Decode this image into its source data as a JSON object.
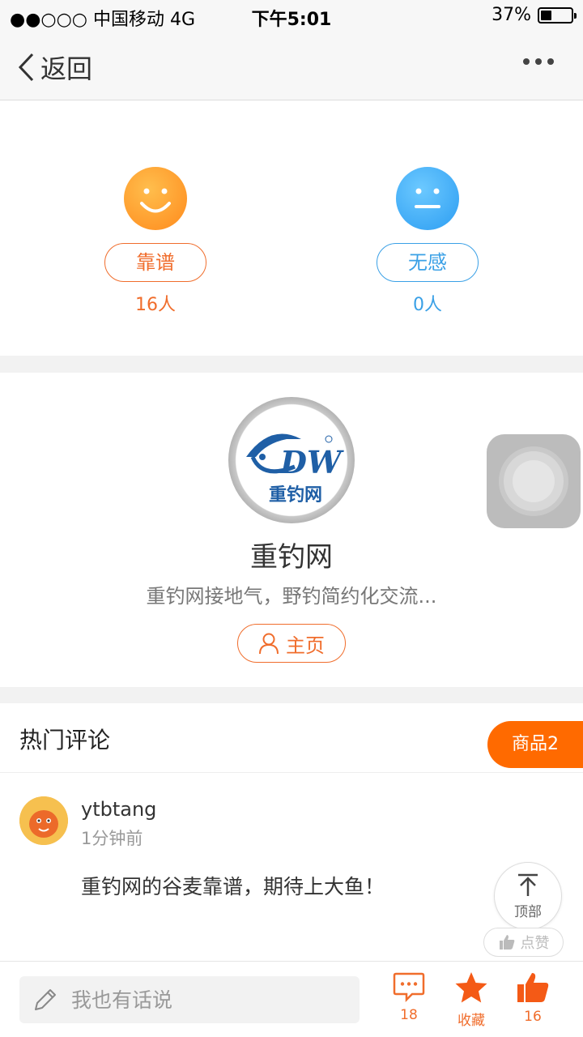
{
  "status_bar": {
    "carrier": "●●○○○ 中国移动   4G",
    "time": "下午5:01",
    "battery": "37%",
    "battery_level": 0.37
  },
  "nav": {
    "back_label": "返回"
  },
  "vote": {
    "good": {
      "label": "靠谱",
      "count": "16人"
    },
    "meh": {
      "label": "无感",
      "count": "0人"
    }
  },
  "profile": {
    "logo_text": "重钓网",
    "name": "重钓网",
    "description": "重钓网接地气，野钓简约化交流...",
    "home_button": "主页"
  },
  "comments": {
    "title": "热门评论",
    "goods_button": "商品2",
    "items": [
      {
        "user": "ytbtang",
        "time": "1分钟前",
        "text": "重钓网的谷麦靠谱，期待上大鱼！"
      }
    ],
    "like_label": "点赞"
  },
  "back_to_top": "顶部",
  "bottom_bar": {
    "input_placeholder": "我也有话说",
    "comments_count": "18",
    "favorite_label": "收藏",
    "likes_count": "16"
  },
  "colors": {
    "accent": "#f06d2c",
    "blue": "#3aa0e6",
    "goods_button": "#ff6a00"
  }
}
